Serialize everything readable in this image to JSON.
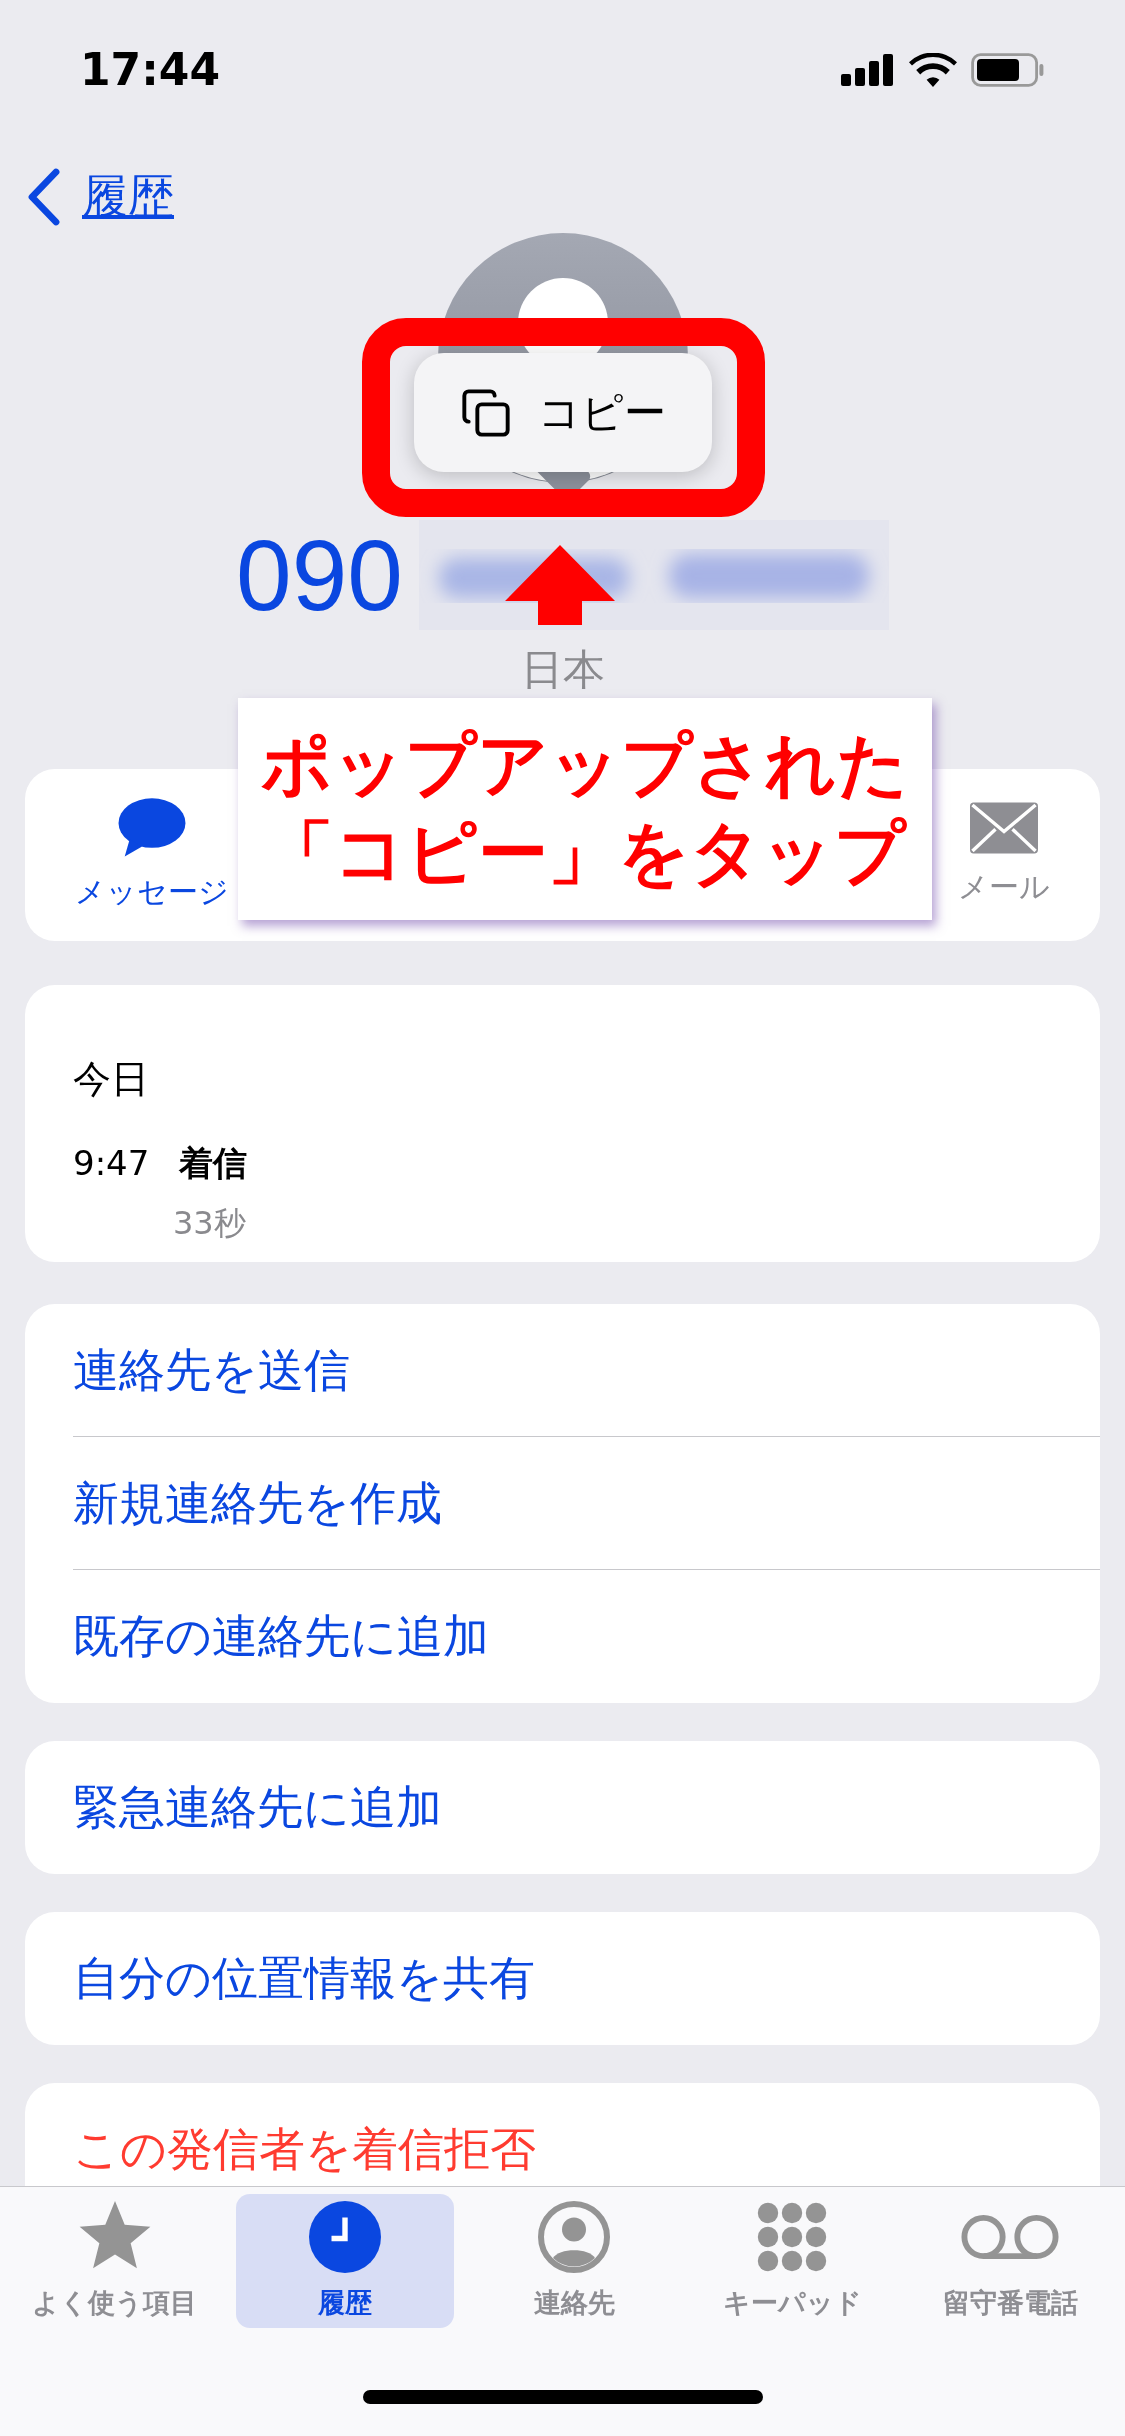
{
  "status_bar": {
    "time": "17:44"
  },
  "nav": {
    "back_label": "履歴"
  },
  "popup_menu": {
    "items": [
      {
        "label": "コピー",
        "kind": "copy"
      }
    ]
  },
  "contact": {
    "number_visible": "090",
    "region": "日本"
  },
  "actions": [
    {
      "label": "メッセージ",
      "kind": "message"
    },
    {
      "label": "メール",
      "kind": "mail"
    }
  ],
  "annotation": {
    "lines": [
      "ポップアップされた",
      "「コピー」をタップ"
    ]
  },
  "recents": {
    "date": "今日",
    "calls": [
      {
        "time": "9:47",
        "type": "着信",
        "duration": "33秒"
      }
    ]
  },
  "groups": [
    {
      "items": [
        {
          "label": "連絡先を送信",
          "kind": "normal"
        },
        {
          "label": "新規連絡先を作成",
          "kind": "normal"
        },
        {
          "label": "既存の連絡先に追加",
          "kind": "normal"
        }
      ]
    },
    {
      "items": [
        {
          "label": "緊急連絡先に追加",
          "kind": "normal"
        }
      ]
    },
    {
      "items": [
        {
          "label": "自分の位置情報を共有",
          "kind": "normal"
        }
      ]
    },
    {
      "items": [
        {
          "label": "この発信者を着信拒否",
          "kind": "destructive"
        }
      ]
    }
  ],
  "tabs": [
    {
      "label": "よく使う項目",
      "kind": "favorites",
      "selected": false
    },
    {
      "label": "履歴",
      "kind": "recents",
      "selected": true
    },
    {
      "label": "連絡先",
      "kind": "contacts",
      "selected": false
    },
    {
      "label": "キーパッド",
      "kind": "keypad",
      "selected": false
    },
    {
      "label": "留守番電話",
      "kind": "voicemail",
      "selected": false
    }
  ]
}
